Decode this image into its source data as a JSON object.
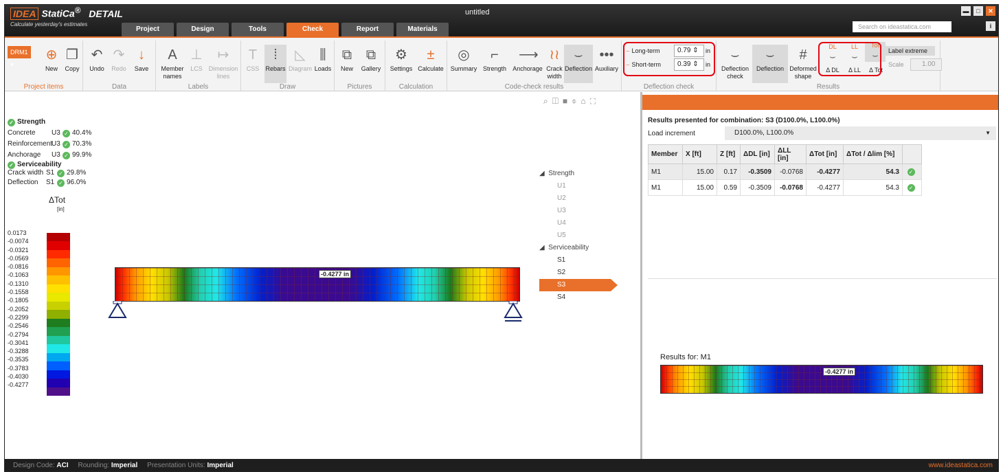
{
  "app": {
    "logo": "IDEA",
    "product": "StatiCa",
    "reg": "®",
    "module": "DETAIL",
    "tagline": "Calculate yesterday's estimates",
    "window_title": "untitled",
    "search_placeholder": "Search on ideastatica.com",
    "tabs": [
      "Project",
      "Design",
      "Tools",
      "Check",
      "Report",
      "Materials"
    ],
    "active_tab": "Check",
    "accent_color": "#e8702a"
  },
  "ribbon": {
    "project_items": {
      "selector": "DRM1",
      "new": "New",
      "copy": "Copy",
      "label": "Project items"
    },
    "data": {
      "undo": "Undo",
      "redo": "Redo",
      "save": "Save",
      "label": "Data"
    },
    "labels": {
      "member_names": "Member names",
      "lcs": "LCS",
      "dimension_lines": "Dimension lines",
      "label": "Labels"
    },
    "draw": {
      "css": "CSS",
      "rebars": "Rebars",
      "diagram": "Diagram",
      "loads": "Loads",
      "label": "Draw"
    },
    "pictures": {
      "new": "New",
      "gallery": "Gallery",
      "label": "Pictures"
    },
    "calculation": {
      "settings": "Settings",
      "calculate": "Calculate",
      "label": "Calculation"
    },
    "code_check": {
      "summary": "Summary",
      "strength": "Strength",
      "anchorage": "Anchorage",
      "crack_width": "Crack width",
      "deflection": "Deflection",
      "auxiliary": "Auxiliary",
      "label": "Code-check results"
    },
    "deflection_check": {
      "long_term": "Long-term",
      "long_value": "0.79",
      "short_term": "Short-term",
      "short_value": "0.39",
      "unit": "in",
      "label": "Deflection check"
    },
    "results": {
      "deflection_check": "Deflection check",
      "deflection": "Deflection",
      "deformed_shape": "Deformed shape",
      "dl": "DL",
      "ll": "LL",
      "tot": "Tot",
      "delta_dl": "Δ DL",
      "delta_ll": "Δ LL",
      "delta_tot": "Δ Tot",
      "label_extreme": "Label extreme",
      "scale_label": "Scale",
      "scale_value": "1.00",
      "label": "Results"
    }
  },
  "checks": {
    "strength_title": "Strength",
    "strength": [
      {
        "name": "Concrete",
        "code": "U3",
        "value": "40.4%"
      },
      {
        "name": "Reinforcement",
        "code": "U3",
        "value": "70.3%"
      },
      {
        "name": "Anchorage",
        "code": "U3",
        "value": "99.9%"
      }
    ],
    "serviceability_title": "Serviceability",
    "serviceability": [
      {
        "name": "Crack width",
        "code": "S1",
        "value": "29.8%"
      },
      {
        "name": "Deflection",
        "code": "S1",
        "value": "96.0%"
      }
    ]
  },
  "legend": {
    "title": "ΔTot",
    "unit": "[in]",
    "values": [
      "0.0173",
      "-0.0074",
      "-0.0321",
      "-0.0569",
      "-0.0816",
      "-0.1063",
      "-0.1310",
      "-0.1558",
      "-0.1805",
      "-0.2052",
      "-0.2299",
      "-0.2546",
      "-0.2794",
      "-0.3041",
      "-0.3288",
      "-0.3535",
      "-0.3783",
      "-0.4030",
      "-0.4277"
    ],
    "colors": [
      "#b40000",
      "#e00000",
      "#ff2a00",
      "#ff6400",
      "#ff9600",
      "#ffc000",
      "#ffe000",
      "#e8e800",
      "#c8d000",
      "#90b000",
      "#1e7d1e",
      "#20a050",
      "#20c8a0",
      "#20e8e8",
      "#00a8f0",
      "#0060ff",
      "#0018e0",
      "#2000b0",
      "#50108a"
    ]
  },
  "beam": {
    "max_label": "-0.4277 in",
    "gradient": [
      {
        "pos": 0,
        "color": "#cc0000"
      },
      {
        "pos": 2,
        "color": "#ff3000"
      },
      {
        "pos": 5,
        "color": "#ff9800"
      },
      {
        "pos": 9,
        "color": "#ffe000"
      },
      {
        "pos": 13,
        "color": "#c8c800"
      },
      {
        "pos": 17,
        "color": "#1a7a1a"
      },
      {
        "pos": 21,
        "color": "#20d0b0"
      },
      {
        "pos": 25,
        "color": "#20e8e8"
      },
      {
        "pos": 30,
        "color": "#0070ff"
      },
      {
        "pos": 36,
        "color": "#0020d0"
      },
      {
        "pos": 42,
        "color": "#3a0a90"
      },
      {
        "pos": 58,
        "color": "#3a0a90"
      },
      {
        "pos": 64,
        "color": "#0020d0"
      },
      {
        "pos": 70,
        "color": "#0070ff"
      },
      {
        "pos": 75,
        "color": "#20e8e8"
      },
      {
        "pos": 79,
        "color": "#20d0b0"
      },
      {
        "pos": 83,
        "color": "#1a7a1a"
      },
      {
        "pos": 87,
        "color": "#c8c800"
      },
      {
        "pos": 91,
        "color": "#ffe000"
      },
      {
        "pos": 95,
        "color": "#ff9800"
      },
      {
        "pos": 98,
        "color": "#ff3000"
      },
      {
        "pos": 100,
        "color": "#cc0000"
      }
    ]
  },
  "tree": {
    "strength": "Strength",
    "strength_items": [
      "U1",
      "U2",
      "U3",
      "U4",
      "U5"
    ],
    "serviceability": "Serviceability",
    "serviceability_items": [
      "S1",
      "S2",
      "S3",
      "S4"
    ],
    "selected": "S3"
  },
  "results_panel": {
    "title": "Results presented for combination: S3 (D100.0%, L100.0%)",
    "load_increment_label": "Load increment",
    "load_increment_value": "D100.0%, L100.0%",
    "columns": [
      "Member",
      "X [ft]",
      "Z [ft]",
      "ΔDL [in]",
      "ΔLL [in]",
      "ΔTot [in]",
      "ΔTot / Δlim [%]",
      ""
    ],
    "rows": [
      {
        "member": "M1",
        "x": "15.00",
        "z": "0.17",
        "dl": "-0.3509",
        "ll": "-0.0768",
        "tot": "-0.4277",
        "ratio": "54.3",
        "bold": [
          "dl",
          "tot",
          "ratio"
        ]
      },
      {
        "member": "M1",
        "x": "15.00",
        "z": "0.59",
        "dl": "-0.3509",
        "ll": "-0.0768",
        "tot": "-0.4277",
        "ratio": "54.3",
        "bold": [
          "ll"
        ]
      }
    ],
    "results_for": "Results for: M1",
    "beam_label": "-0.4277 in"
  },
  "status": {
    "design_code_label": "Design Code:",
    "design_code": "ACI",
    "rounding_label": "Rounding:",
    "rounding": "Imperial",
    "units_label": "Presentation Units:",
    "units": "Imperial",
    "url": "www.ideastatica.com"
  }
}
